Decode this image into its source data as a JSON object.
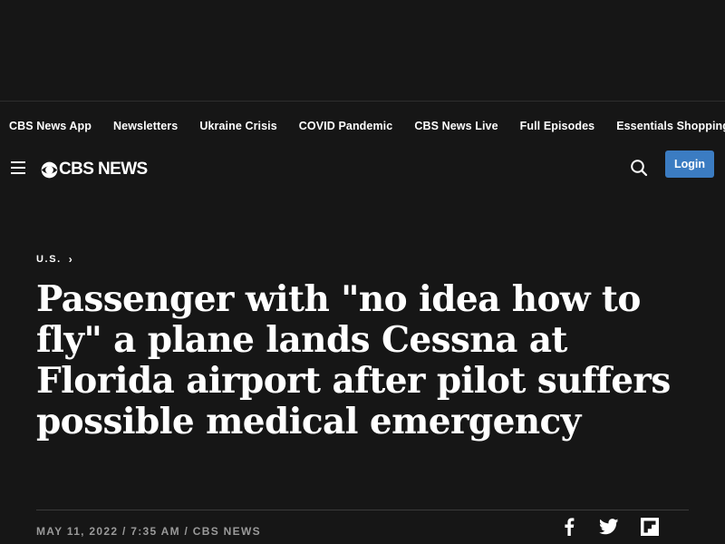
{
  "topnav": {
    "items": [
      "CBS News App",
      "Newsletters",
      "Ukraine Crisis",
      "COVID Pandemic",
      "CBS News Live",
      "Full Episodes",
      "Essentials Shopping"
    ]
  },
  "header": {
    "logo_text": "CBS NEWS",
    "login_label": "Login"
  },
  "article": {
    "section": "U.S.",
    "headline": "Passenger with \"no idea how to fly\" a plane lands Cessna at Florida airport after pilot suffers possible medical emergency",
    "meta": "MAY 11, 2022 / 7:35 AM / CBS NEWS"
  },
  "icons": {
    "menu": "hamburger-menu-icon",
    "search": "search-icon",
    "facebook": "facebook-icon",
    "twitter": "twitter-icon",
    "flipboard": "flipboard-icon"
  },
  "colors": {
    "background": "#161616",
    "login_button": "#3b7cc2",
    "meta_text": "#9a9a9a"
  }
}
